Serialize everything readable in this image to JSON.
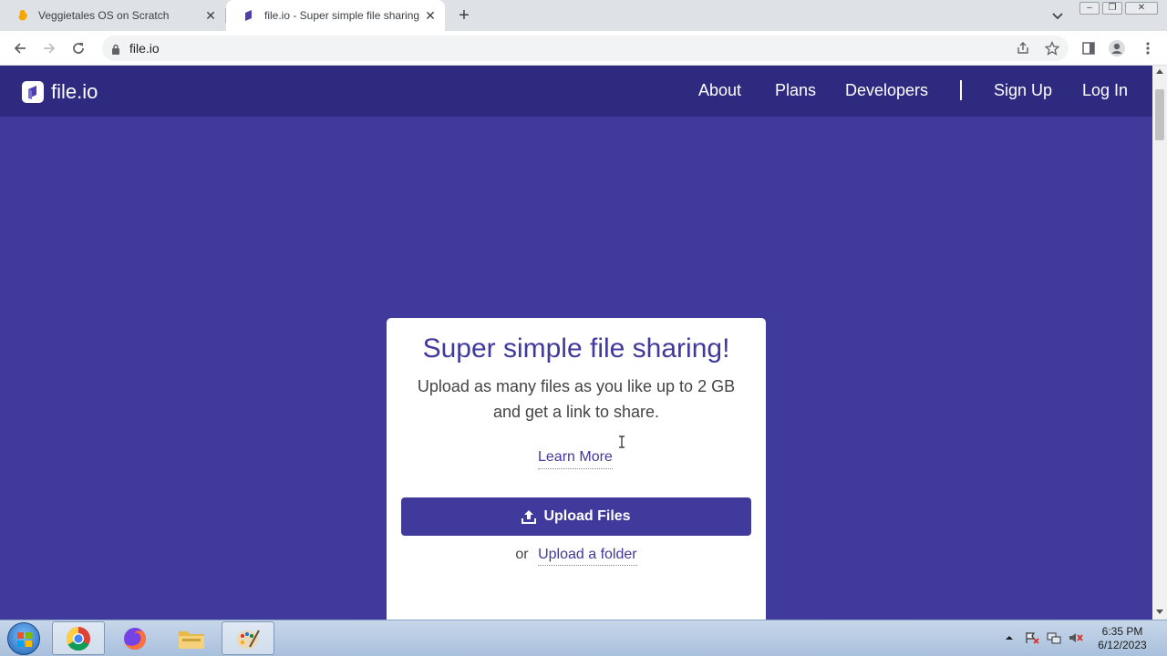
{
  "browser": {
    "tabs": [
      {
        "title": "Veggietales OS on Scratch",
        "active": false
      },
      {
        "title": "file.io - Super simple file sharing",
        "active": true
      }
    ],
    "address": "file.io"
  },
  "site": {
    "brand": "file.io",
    "nav": {
      "about": "About",
      "plans": "Plans",
      "developers": "Developers",
      "signup": "Sign Up",
      "login": "Log In"
    },
    "card": {
      "title": "Super simple file sharing!",
      "subtitle": "Upload as many files as you like up to 2 GB and get a link to share.",
      "learn_more": "Learn More",
      "upload_button": "Upload Files",
      "or": "or",
      "upload_folder": "Upload a folder"
    }
  },
  "taskbar": {
    "time": "6:35 PM",
    "date": "6/12/2023"
  },
  "colors": {
    "page_bg": "#3f3a9c",
    "nav_bg": "#2d2a80",
    "accent": "#3f3a9c"
  }
}
